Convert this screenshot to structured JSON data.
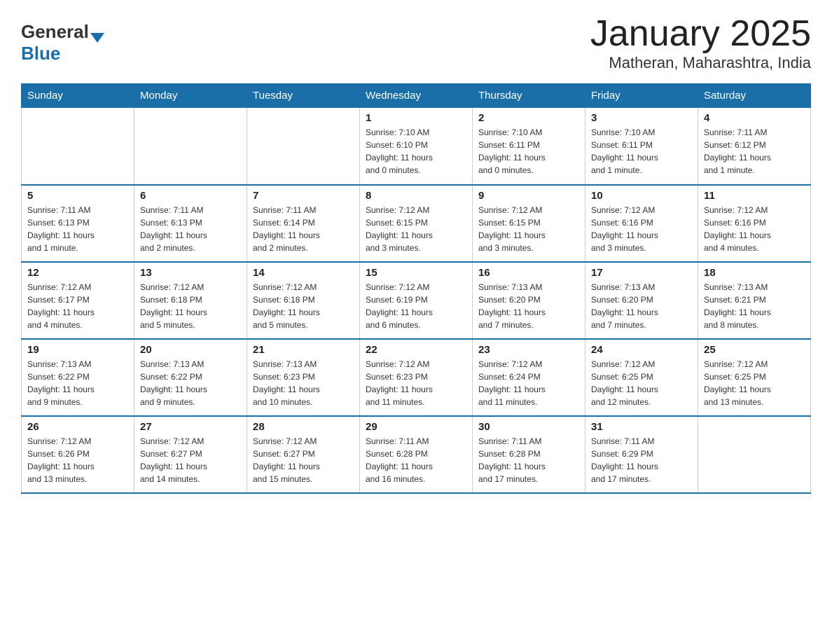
{
  "header": {
    "logo_general": "General",
    "logo_blue": "Blue",
    "month_title": "January 2025",
    "location": "Matheran, Maharashtra, India"
  },
  "days_of_week": [
    "Sunday",
    "Monday",
    "Tuesday",
    "Wednesday",
    "Thursday",
    "Friday",
    "Saturday"
  ],
  "weeks": [
    [
      {
        "day": "",
        "info": ""
      },
      {
        "day": "",
        "info": ""
      },
      {
        "day": "",
        "info": ""
      },
      {
        "day": "1",
        "info": "Sunrise: 7:10 AM\nSunset: 6:10 PM\nDaylight: 11 hours\nand 0 minutes."
      },
      {
        "day": "2",
        "info": "Sunrise: 7:10 AM\nSunset: 6:11 PM\nDaylight: 11 hours\nand 0 minutes."
      },
      {
        "day": "3",
        "info": "Sunrise: 7:10 AM\nSunset: 6:11 PM\nDaylight: 11 hours\nand 1 minute."
      },
      {
        "day": "4",
        "info": "Sunrise: 7:11 AM\nSunset: 6:12 PM\nDaylight: 11 hours\nand 1 minute."
      }
    ],
    [
      {
        "day": "5",
        "info": "Sunrise: 7:11 AM\nSunset: 6:13 PM\nDaylight: 11 hours\nand 1 minute."
      },
      {
        "day": "6",
        "info": "Sunrise: 7:11 AM\nSunset: 6:13 PM\nDaylight: 11 hours\nand 2 minutes."
      },
      {
        "day": "7",
        "info": "Sunrise: 7:11 AM\nSunset: 6:14 PM\nDaylight: 11 hours\nand 2 minutes."
      },
      {
        "day": "8",
        "info": "Sunrise: 7:12 AM\nSunset: 6:15 PM\nDaylight: 11 hours\nand 3 minutes."
      },
      {
        "day": "9",
        "info": "Sunrise: 7:12 AM\nSunset: 6:15 PM\nDaylight: 11 hours\nand 3 minutes."
      },
      {
        "day": "10",
        "info": "Sunrise: 7:12 AM\nSunset: 6:16 PM\nDaylight: 11 hours\nand 3 minutes."
      },
      {
        "day": "11",
        "info": "Sunrise: 7:12 AM\nSunset: 6:16 PM\nDaylight: 11 hours\nand 4 minutes."
      }
    ],
    [
      {
        "day": "12",
        "info": "Sunrise: 7:12 AM\nSunset: 6:17 PM\nDaylight: 11 hours\nand 4 minutes."
      },
      {
        "day": "13",
        "info": "Sunrise: 7:12 AM\nSunset: 6:18 PM\nDaylight: 11 hours\nand 5 minutes."
      },
      {
        "day": "14",
        "info": "Sunrise: 7:12 AM\nSunset: 6:18 PM\nDaylight: 11 hours\nand 5 minutes."
      },
      {
        "day": "15",
        "info": "Sunrise: 7:12 AM\nSunset: 6:19 PM\nDaylight: 11 hours\nand 6 minutes."
      },
      {
        "day": "16",
        "info": "Sunrise: 7:13 AM\nSunset: 6:20 PM\nDaylight: 11 hours\nand 7 minutes."
      },
      {
        "day": "17",
        "info": "Sunrise: 7:13 AM\nSunset: 6:20 PM\nDaylight: 11 hours\nand 7 minutes."
      },
      {
        "day": "18",
        "info": "Sunrise: 7:13 AM\nSunset: 6:21 PM\nDaylight: 11 hours\nand 8 minutes."
      }
    ],
    [
      {
        "day": "19",
        "info": "Sunrise: 7:13 AM\nSunset: 6:22 PM\nDaylight: 11 hours\nand 9 minutes."
      },
      {
        "day": "20",
        "info": "Sunrise: 7:13 AM\nSunset: 6:22 PM\nDaylight: 11 hours\nand 9 minutes."
      },
      {
        "day": "21",
        "info": "Sunrise: 7:13 AM\nSunset: 6:23 PM\nDaylight: 11 hours\nand 10 minutes."
      },
      {
        "day": "22",
        "info": "Sunrise: 7:12 AM\nSunset: 6:23 PM\nDaylight: 11 hours\nand 11 minutes."
      },
      {
        "day": "23",
        "info": "Sunrise: 7:12 AM\nSunset: 6:24 PM\nDaylight: 11 hours\nand 11 minutes."
      },
      {
        "day": "24",
        "info": "Sunrise: 7:12 AM\nSunset: 6:25 PM\nDaylight: 11 hours\nand 12 minutes."
      },
      {
        "day": "25",
        "info": "Sunrise: 7:12 AM\nSunset: 6:25 PM\nDaylight: 11 hours\nand 13 minutes."
      }
    ],
    [
      {
        "day": "26",
        "info": "Sunrise: 7:12 AM\nSunset: 6:26 PM\nDaylight: 11 hours\nand 13 minutes."
      },
      {
        "day": "27",
        "info": "Sunrise: 7:12 AM\nSunset: 6:27 PM\nDaylight: 11 hours\nand 14 minutes."
      },
      {
        "day": "28",
        "info": "Sunrise: 7:12 AM\nSunset: 6:27 PM\nDaylight: 11 hours\nand 15 minutes."
      },
      {
        "day": "29",
        "info": "Sunrise: 7:11 AM\nSunset: 6:28 PM\nDaylight: 11 hours\nand 16 minutes."
      },
      {
        "day": "30",
        "info": "Sunrise: 7:11 AM\nSunset: 6:28 PM\nDaylight: 11 hours\nand 17 minutes."
      },
      {
        "day": "31",
        "info": "Sunrise: 7:11 AM\nSunset: 6:29 PM\nDaylight: 11 hours\nand 17 minutes."
      },
      {
        "day": "",
        "info": ""
      }
    ]
  ]
}
